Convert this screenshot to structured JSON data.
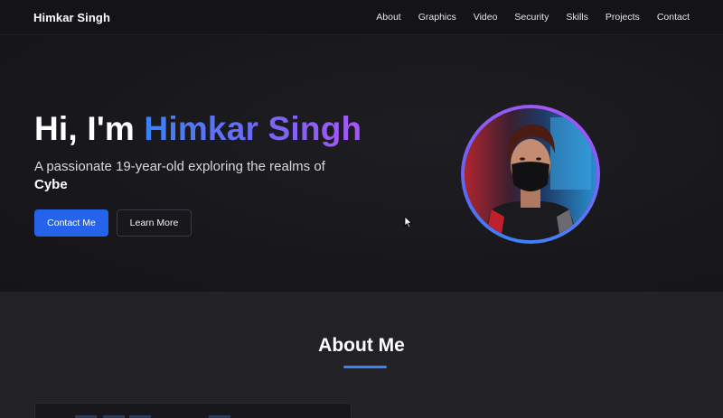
{
  "nav": {
    "brand": "Himkar Singh",
    "links": [
      "About",
      "Graphics",
      "Video",
      "Security",
      "Skills",
      "Projects",
      "Contact"
    ]
  },
  "hero": {
    "greeting": "Hi, I'm ",
    "name": "Himkar Singh",
    "subtitle": "A passionate 19-year-old exploring the realms of",
    "typed_text": "Cybe",
    "primary_button": "Contact Me",
    "secondary_button": "Learn More"
  },
  "about": {
    "title": "About Me"
  },
  "colors": {
    "accent": "#2563eb",
    "gradient_start": "#3b82f6",
    "gradient_end": "#a855f7",
    "background": "#17171b"
  }
}
